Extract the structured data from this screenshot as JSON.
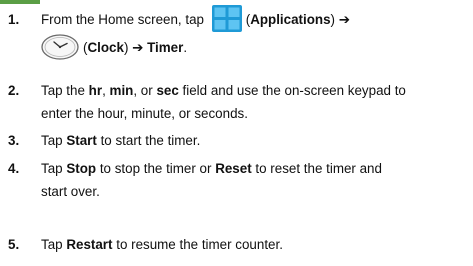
{
  "steps": [
    {
      "number": "1.",
      "line1_before": "From the Home screen, tap",
      "apps_label": "Applications",
      "arrow1": "➔",
      "clock_label": "Clock",
      "arrow2": "➔",
      "timer_label": "Timer",
      "end": "."
    },
    {
      "number": "2.",
      "line1_pre": "Tap the",
      "hr": "hr",
      "comma1": ",",
      "min": "min",
      "or": ", or",
      "sec": "sec",
      "line1_post": "field and use the on-screen keypad to",
      "line2": "enter the hour, minute, or seconds."
    },
    {
      "number": "3.",
      "pre": "Tap",
      "start": "Start",
      "post": "to start the timer."
    },
    {
      "number": "4.",
      "pre": "Tap",
      "stop": "Stop",
      "mid": "to stop the timer or",
      "reset": "Reset",
      "post": "to reset the timer and",
      "line2": "start over."
    },
    {
      "number": "5.",
      "pre": "Tap",
      "restart": "Restart",
      "post": "to resume the timer counter."
    }
  ],
  "colors": {
    "apps_icon_blue": "#1f9ad6",
    "accent_green": "#5b9e45",
    "text": "#111111"
  },
  "icons": {
    "apps": "applications-grid-icon",
    "clock": "clock-icon"
  }
}
